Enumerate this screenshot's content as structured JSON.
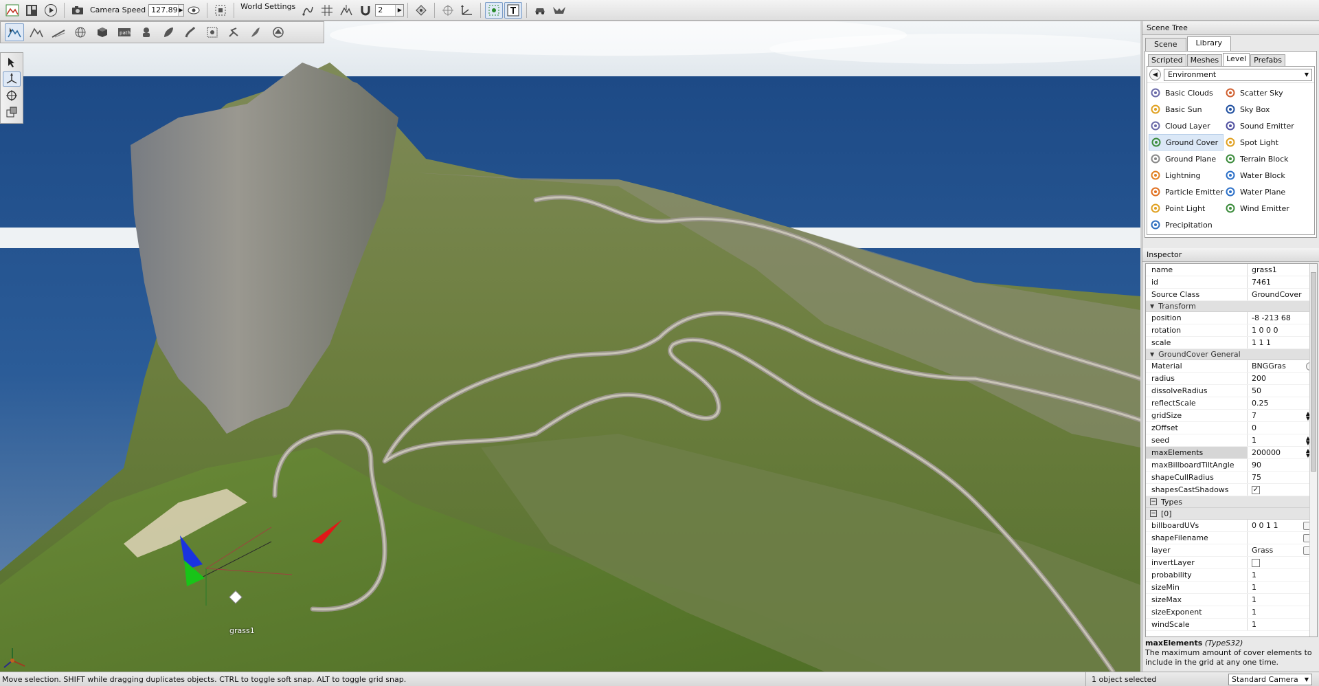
{
  "toolbar": {
    "camera_speed_label": "Camera Speed",
    "camera_speed_value": "127.89",
    "world_settings_label": "World Settings",
    "snap_value": "2"
  },
  "tool_palette": {
    "icons": [
      "terrain-select-icon",
      "terrain-brush-icon",
      "terrain-smooth-icon",
      "globe-icon",
      "cube-icon",
      "path-icon",
      "spawn-icon",
      "forest-icon",
      "road-icon",
      "decal-icon",
      "river-icon",
      "mesh-road-icon",
      "car-icon"
    ]
  },
  "viewport": {
    "object_label": "grass1"
  },
  "scene_tree": {
    "title": "Scene Tree",
    "tabs": [
      "Scene",
      "Library"
    ],
    "active_tab": "Library",
    "subtabs": [
      "Scripted",
      "Meshes",
      "Level",
      "Prefabs"
    ],
    "active_subtab": "Level",
    "category": "Environment",
    "items_left": [
      {
        "label": "Basic Clouds",
        "icon": "clouds-icon",
        "color": "#6a6aa8"
      },
      {
        "label": "Basic Sun",
        "icon": "sun-icon",
        "color": "#e0a020"
      },
      {
        "label": "Cloud Layer",
        "icon": "cloud-layer-icon",
        "color": "#6a6aa8"
      },
      {
        "label": "Ground Cover",
        "icon": "ground-cover-icon",
        "color": "#3c8c3c"
      },
      {
        "label": "Ground Plane",
        "icon": "ground-plane-icon",
        "color": "#888888"
      },
      {
        "label": "Lightning",
        "icon": "lightning-icon",
        "color": "#e08020"
      },
      {
        "label": "Particle Emitter",
        "icon": "particle-emitter-icon",
        "color": "#e07020"
      },
      {
        "label": "Point Light",
        "icon": "point-light-icon",
        "color": "#e0a020"
      },
      {
        "label": "Precipitation",
        "icon": "precipitation-icon",
        "color": "#3070c0"
      }
    ],
    "items_right": [
      {
        "label": "Scatter Sky",
        "icon": "scatter-sky-icon",
        "color": "#d06030"
      },
      {
        "label": "Sky Box",
        "icon": "sky-box-icon",
        "color": "#2050a0"
      },
      {
        "label": "Sound Emitter",
        "icon": "sound-emitter-icon",
        "color": "#5050a0"
      },
      {
        "label": "Spot Light",
        "icon": "spot-light-icon",
        "color": "#e0a020"
      },
      {
        "label": "Terrain Block",
        "icon": "terrain-block-icon",
        "color": "#3c8c3c"
      },
      {
        "label": "Water Block",
        "icon": "water-block-icon",
        "color": "#2c70c8"
      },
      {
        "label": "Water Plane",
        "icon": "water-plane-icon",
        "color": "#2c70c8"
      },
      {
        "label": "Wind Emitter",
        "icon": "wind-emitter-icon",
        "color": "#3c8c3c"
      }
    ],
    "selected": "Ground Cover"
  },
  "inspector": {
    "title": "Inspector",
    "name_key": "name",
    "name_val": "grass1",
    "id_key": "id",
    "id_val": "7461",
    "class_key": "Source Class",
    "class_val": "GroundCover",
    "transform_group": "Transform",
    "position_key": "position",
    "position_val": "-8 -213 68",
    "rotation_key": "rotation",
    "rotation_val": "1 0 0 0",
    "scale_key": "scale",
    "scale_val": "1 1 1",
    "general_group": "GroundCover General",
    "material_key": "Material",
    "material_val": "BNGGras",
    "radius_key": "radius",
    "radius_val": "200",
    "dissolve_key": "dissolveRadius",
    "dissolve_val": "50",
    "reflect_key": "reflectScale",
    "reflect_val": "0.25",
    "grid_key": "gridSize",
    "grid_val": "7",
    "zoff_key": "zOffset",
    "zoff_val": "0",
    "seed_key": "seed",
    "seed_val": "1",
    "maxel_key": "maxElements",
    "maxel_val": "200000",
    "tilt_key": "maxBillboardTiltAngle",
    "tilt_val": "90",
    "cull_key": "shapeCullRadius",
    "cull_val": "75",
    "shadows_key": "shapesCastShadows",
    "types_group": "Types",
    "types_item": "[0]",
    "uv_key": "billboardUVs",
    "uv_val": "0 0 1 1",
    "shape_key": "shapeFilename",
    "layer_key": "layer",
    "layer_val": "Grass",
    "invert_key": "invertLayer",
    "prob_key": "probability",
    "prob_val": "1",
    "smin_key": "sizeMin",
    "smin_val": "1",
    "smax_key": "sizeMax",
    "smax_val": "1",
    "sexp_key": "sizeExponent",
    "sexp_val": "1",
    "wind_key": "windScale",
    "wind_val": "1",
    "help_field": "maxElements",
    "help_type": "(TypeS32)",
    "help_text": "The maximum amount of cover elements to include in the grid at any one time."
  },
  "status": {
    "message": "Move selection.  SHIFT while dragging duplicates objects.  CTRL to toggle soft snap.  ALT to toggle grid snap.",
    "selection": "1 object selected",
    "camera": "Standard Camera"
  }
}
